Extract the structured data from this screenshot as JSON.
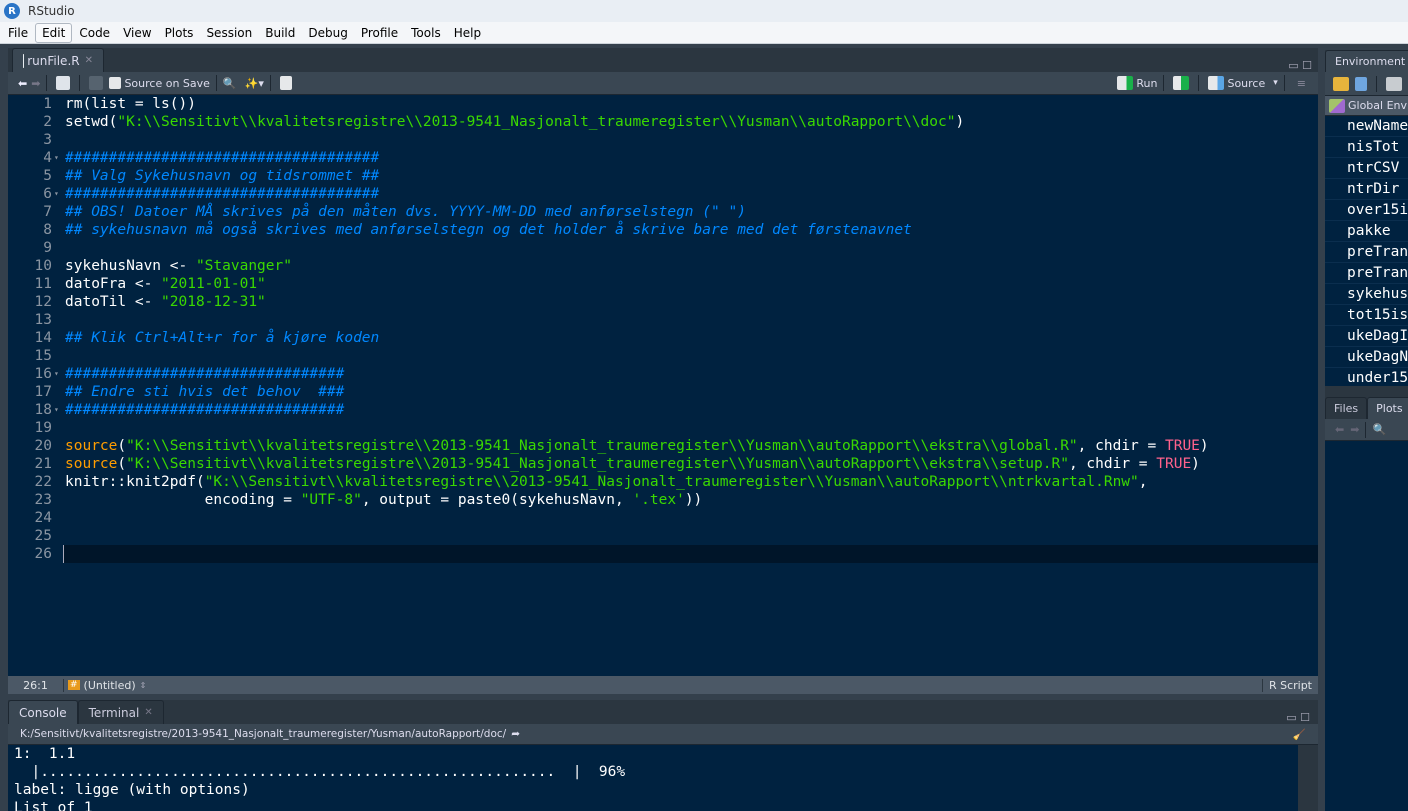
{
  "window": {
    "title": "RStudio"
  },
  "menu": [
    "File",
    "Edit",
    "Code",
    "View",
    "Plots",
    "Session",
    "Build",
    "Debug",
    "Profile",
    "Tools",
    "Help"
  ],
  "editor": {
    "tab": "runFile.R",
    "source_on_save": "Source on Save",
    "run_label": "Run",
    "source_label": "Source",
    "lines": [
      [
        [
          "pl",
          "rm(list = ls())"
        ]
      ],
      [
        [
          "pl",
          "setwd("
        ],
        [
          "st",
          "\"K:\\\\Sensitivt\\\\kvalitetsregistre\\\\2013-9541_Nasjonalt_traumeregister\\\\Yusman\\\\autoRapport\\\\doc\""
        ],
        [
          "pl",
          ")"
        ]
      ],
      [],
      [
        [
          "cm",
          "####################################"
        ]
      ],
      [
        [
          "cm",
          "## Valg Sykehusnavn og tidsrommet ##"
        ]
      ],
      [
        [
          "cm",
          "####################################"
        ]
      ],
      [
        [
          "cm",
          "## OBS! Datoer MÅ skrives på den måten dvs. YYYY-MM-DD med anførselstegn (\" \")"
        ]
      ],
      [
        [
          "cm",
          "## sykehusnavn må også skrives med anførselstegn og det holder å skrive bare med det førstenavnet"
        ]
      ],
      [],
      [
        [
          "pl",
          "sykehusNavn <- "
        ],
        [
          "st",
          "\"Stavanger\""
        ]
      ],
      [
        [
          "pl",
          "datoFra <- "
        ],
        [
          "st",
          "\"2011-01-01\""
        ]
      ],
      [
        [
          "pl",
          "datoTil <- "
        ],
        [
          "st",
          "\"2018-12-31\""
        ]
      ],
      [],
      [
        [
          "cm",
          "## Klik Ctrl+Alt+r for å kjøre koden"
        ]
      ],
      [],
      [
        [
          "cm",
          "################################"
        ]
      ],
      [
        [
          "cm",
          "## Endre sti hvis det behov  ###"
        ]
      ],
      [
        [
          "cm",
          "################################"
        ]
      ],
      [],
      [
        [
          "kw",
          "source"
        ],
        [
          "pl",
          "("
        ],
        [
          "st",
          "\"K:\\\\Sensitivt\\\\kvalitetsregistre\\\\2013-9541_Nasjonalt_traumeregister\\\\Yusman\\\\autoRapport\\\\ekstra\\\\global.R\""
        ],
        [
          "pl",
          ", chdir = "
        ],
        [
          "cn",
          "TRUE"
        ],
        [
          "pl",
          ")"
        ]
      ],
      [
        [
          "kw",
          "source"
        ],
        [
          "pl",
          "("
        ],
        [
          "st",
          "\"K:\\\\Sensitivt\\\\kvalitetsregistre\\\\2013-9541_Nasjonalt_traumeregister\\\\Yusman\\\\autoRapport\\\\ekstra\\\\setup.R\""
        ],
        [
          "pl",
          ", chdir = "
        ],
        [
          "cn",
          "TRUE"
        ],
        [
          "pl",
          ")"
        ]
      ],
      [
        [
          "pl",
          "knitr::knit2pdf("
        ],
        [
          "st",
          "\"K:\\\\Sensitivt\\\\kvalitetsregistre\\\\2013-9541_Nasjonalt_traumeregister\\\\Yusman\\\\autoRapport\\\\ntrkvartal.Rnw\""
        ],
        [
          "pl",
          ","
        ]
      ],
      [
        [
          "pl",
          "                encoding = "
        ],
        [
          "st",
          "\"UTF-8\""
        ],
        [
          "pl",
          ", output = paste0(sykehusNavn, "
        ],
        [
          "st",
          "'.tex'"
        ],
        [
          "pl",
          "))"
        ]
      ],
      [],
      [],
      []
    ],
    "fold_lines": [
      4,
      6,
      16,
      18
    ],
    "current_line": 26,
    "status": {
      "position": "26:1",
      "scope": "(Untitled)",
      "filetype": "R Script"
    }
  },
  "console": {
    "tabs": [
      "Console",
      "Terminal"
    ],
    "path": "K:/Sensitivt/kvalitetsregistre/2013-9541_Nasjonalt_traumeregister/Yusman/autoRapport/doc/",
    "output": [
      "1:  1.1",
      "  |...........................................................  |  96%",
      "label: ligge (with options)",
      "List of 1"
    ],
    "progress_percent": 96
  },
  "environment": {
    "tab": "Environment",
    "scope": "Global Env",
    "items": [
      "newName",
      "nisTot",
      "ntrCSV",
      "ntrDir",
      "over15i",
      "pakke",
      "preTran",
      "preTran",
      "sykehus",
      "tot15is",
      "ukeDagI",
      "ukeDagN",
      "under15"
    ]
  },
  "files_pane": {
    "tabs": [
      "Files",
      "Plots"
    ]
  }
}
